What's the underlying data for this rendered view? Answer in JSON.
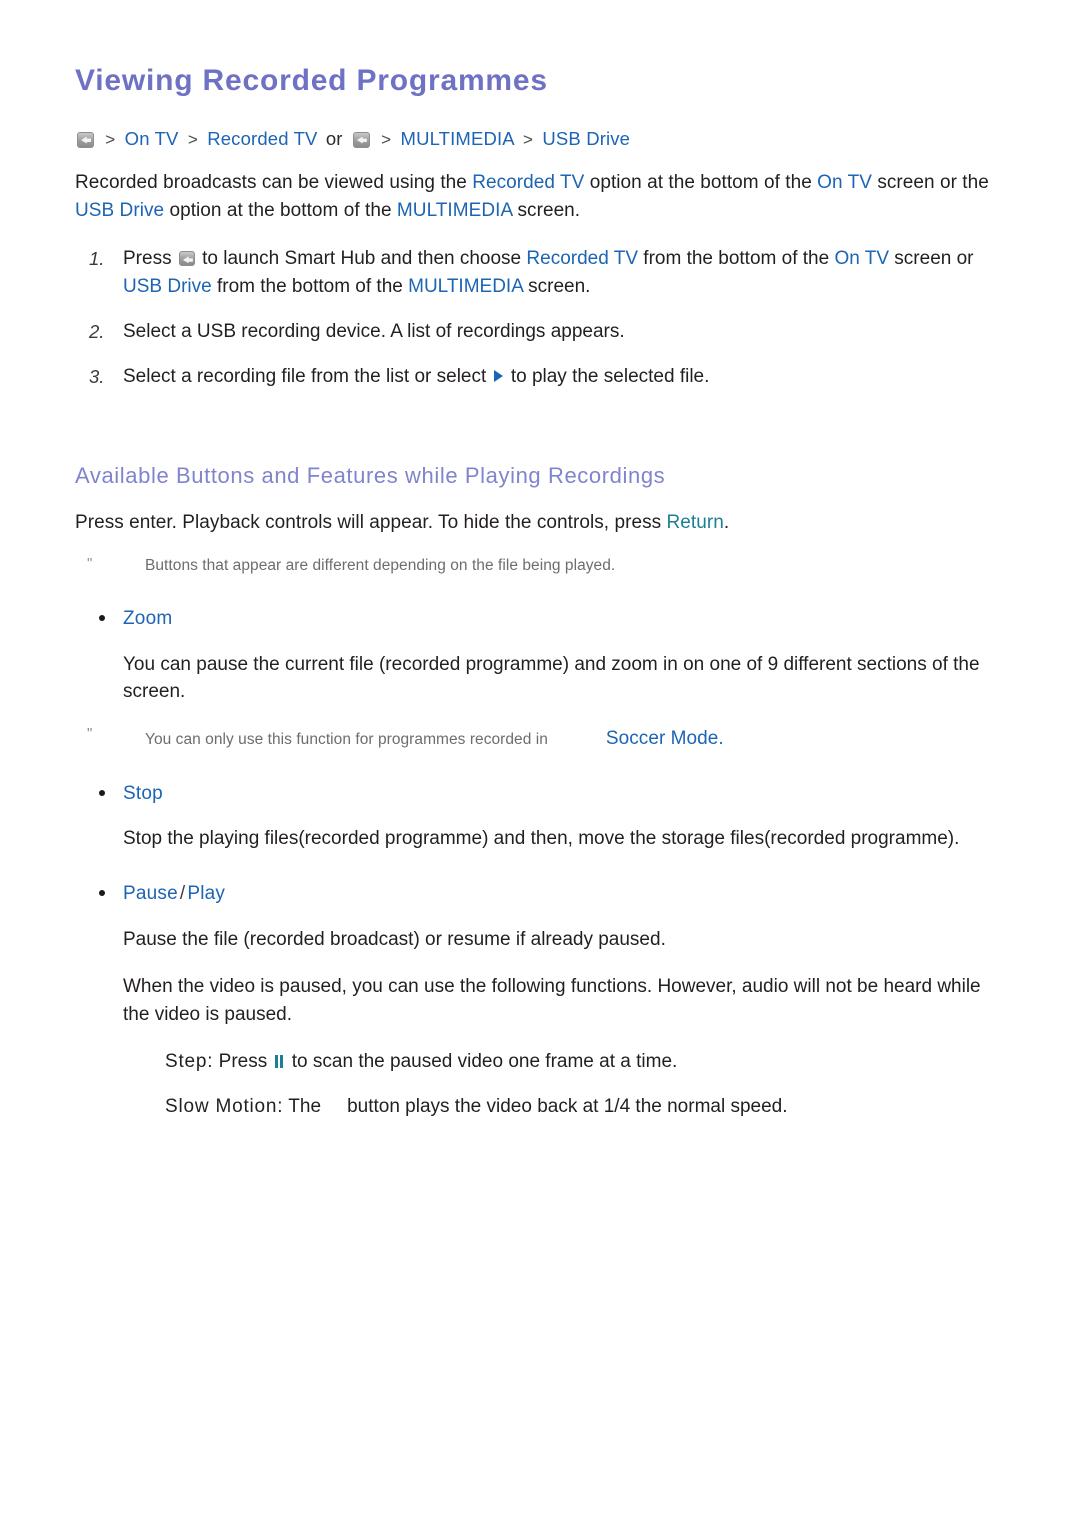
{
  "document": {
    "title": "Viewing Recorded Programmes",
    "breadcrumb": {
      "icon_1": "smart-hub-button-icon",
      "sep_1": ">",
      "crumb_1": "On TV",
      "sep_2": ">",
      "crumb_2": "Recorded TV",
      "conjunction": "or",
      "icon_2": "smart-hub-button-icon",
      "sep_3": ">",
      "crumb_3": "MULTIMEDIA",
      "sep_4": ">",
      "crumb_4": "USB Drive"
    },
    "intro": {
      "part_1": "Recorded broadcasts can be viewed using the ",
      "link_1": "Recorded TV",
      "part_2": " option at the bottom of the ",
      "link_2": "On TV",
      "part_3": " screen or the ",
      "link_3": "USB Drive",
      "part_4": " option at the bottom of the ",
      "link_4": "MULTIMEDIA",
      "part_5": " screen."
    },
    "steps": [
      {
        "num": "1.",
        "part_1": "Press ",
        "icon": "smart-hub-button-icon",
        "part_2": " to launch Smart Hub and then choose ",
        "link_1": "Recorded TV",
        "part_3": " from the bottom of the ",
        "link_2": "On TV",
        "part_4": " screen or ",
        "link_3": "USB Drive",
        "part_5": " from the bottom of the ",
        "link_4": "MULTIMEDIA",
        "part_6": " screen."
      },
      {
        "num": "2.",
        "text": "Select a USB recording device. A list of recordings appears."
      },
      {
        "num": "3.",
        "part_1": "Select a recording file from the list or select ",
        "icon": "play-icon",
        "part_2": " to play the selected file."
      }
    ],
    "section": {
      "title": "Available Buttons and Features while Playing Recordings",
      "intro": {
        "part_1": "Press enter. Playback controls will appear. To hide the controls, press ",
        "link_1": "Return",
        "part_2": "."
      },
      "note": {
        "marker": "\"",
        "text": "Buttons that appear are different depending on the file being played."
      },
      "features": [
        {
          "label": "Zoom",
          "body": "You can pause the current file (recorded programme) and zoom in on one of 9 different sections of the screen.",
          "note": {
            "marker": "\"",
            "part_1": "You can only use this function for programmes recorded in",
            "missing_image": "",
            "link_1": "Soccer Mode",
            "part_2": "."
          }
        },
        {
          "label": "Stop",
          "body": "Stop the playing files(recorded programme) and then, move the storage files(recorded programme)."
        },
        {
          "label_1": "Pause",
          "label_slash": "/",
          "label_2": "Play",
          "body_1": "Pause the file (recorded broadcast) or resume if already paused.",
          "body_2": "When the video is paused, you can use the following functions. However, audio will not be heard while the video is paused.",
          "sub_lines": [
            {
              "term": "Step:",
              "part_1": " Press ",
              "icon": "pause-icon",
              "part_2": " to scan the paused video one frame at a time."
            },
            {
              "term": "Slow Motion:",
              "part_1": " The",
              "missing_image": "",
              "part_2": "button plays the video back at 1/4 the normal speed."
            }
          ]
        }
      ]
    }
  },
  "colors": {
    "title": "#6f72c4",
    "section_title": "#8084cc",
    "link_blue": "#1c64b4",
    "link_teal": "#1d7f93",
    "body_text": "#231f20",
    "note_text": "#6d6d6d",
    "background": "#ffffff"
  }
}
